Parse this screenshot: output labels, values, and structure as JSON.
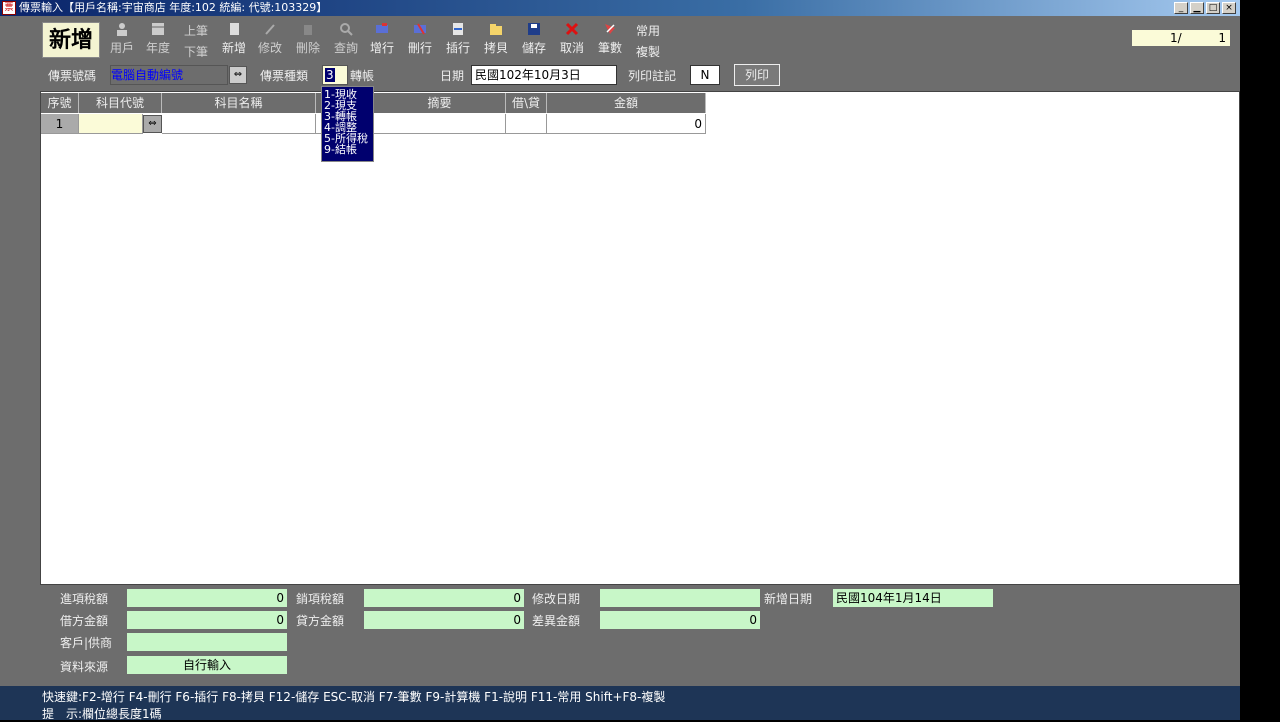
{
  "window": {
    "title": "傳票輸入【用戶名稱:宇宙商店 年度:102 統編: 代號:103329】",
    "app_icon_glyph": "票",
    "minimize_glyph": "_",
    "maximize_glyph": "□",
    "close_glyph": "×"
  },
  "mode_label": "新增",
  "toolbar": {
    "items": [
      {
        "label": "用戶",
        "icon": "user-icon"
      },
      {
        "label": "年度",
        "icon": "calendar-icon"
      },
      {
        "label": "下筆",
        "icon": "next-record-icon",
        "top_label": "上筆"
      },
      {
        "label": "新增",
        "icon": "new-doc-icon"
      },
      {
        "label": "修改",
        "icon": "edit-icon"
      },
      {
        "label": "刪除",
        "icon": "delete-icon"
      },
      {
        "label": "查詢",
        "icon": "search-icon"
      },
      {
        "label": "增行",
        "icon": "add-row-icon"
      },
      {
        "label": "刪行",
        "icon": "delete-row-icon"
      },
      {
        "label": "插行",
        "icon": "insert-row-icon"
      },
      {
        "label": "拷貝",
        "icon": "copy-icon"
      },
      {
        "label": "儲存",
        "icon": "save-icon"
      },
      {
        "label": "取消",
        "icon": "cancel-icon"
      },
      {
        "label": "筆數",
        "icon": "count-icon"
      },
      {
        "label": "複製",
        "icon": "duplicate-icon",
        "top_label": "常用"
      }
    ]
  },
  "record_counter": {
    "current": "1/",
    "total": "1"
  },
  "header": {
    "voucher_no_label": "傳票號碼",
    "voucher_no_value": "電腦自動編號",
    "voucher_type_label": "傳票種類",
    "voucher_type_value": "3",
    "voucher_type_text": "轉帳",
    "date_label": "日期",
    "date_value": "民國102年10月3日",
    "print_flag_label": "列印註記",
    "print_flag_value": "N",
    "print_button": "列印"
  },
  "voucher_type_options": [
    "1-現收",
    "2-現支",
    "3-轉帳",
    "4-調整",
    "5-所得稅",
    "9-結帳"
  ],
  "grid": {
    "columns": [
      "序號",
      "科目代號",
      "科目名稱",
      "",
      "摘要",
      "借\\貸",
      "金額"
    ],
    "rows": [
      {
        "seq": "1",
        "account_code": "",
        "account_name": "",
        "memo": "",
        "dc": "",
        "amount": "0"
      }
    ]
  },
  "summary": {
    "input_tax_label": "進項稅額",
    "input_tax_value": "0",
    "output_tax_label": "銷項稅額",
    "output_tax_value": "0",
    "modified_date_label": "修改日期",
    "modified_date_value": "",
    "created_date_label": "新增日期",
    "created_date_value": "民國104年1月14日",
    "debit_total_label": "借方金額",
    "debit_total_value": "0",
    "credit_total_label": "貸方金額",
    "credit_total_value": "0",
    "difference_label": "差異金額",
    "difference_value": "0",
    "customer_supplier_label": "客戶|供商",
    "customer_supplier_value": "",
    "data_source_label": "資料來源",
    "data_source_value": "自行輸入"
  },
  "status_bar": {
    "shortcuts": "快速鍵:F2-增行 F4-刪行 F6-插行 F8-拷貝 F12-儲存 ESC-取消 F7-筆數 F9-計算機 F1-說明 F11-常用 Shift+F8-複製",
    "hint": "提　示:欄位總長度1碼"
  }
}
